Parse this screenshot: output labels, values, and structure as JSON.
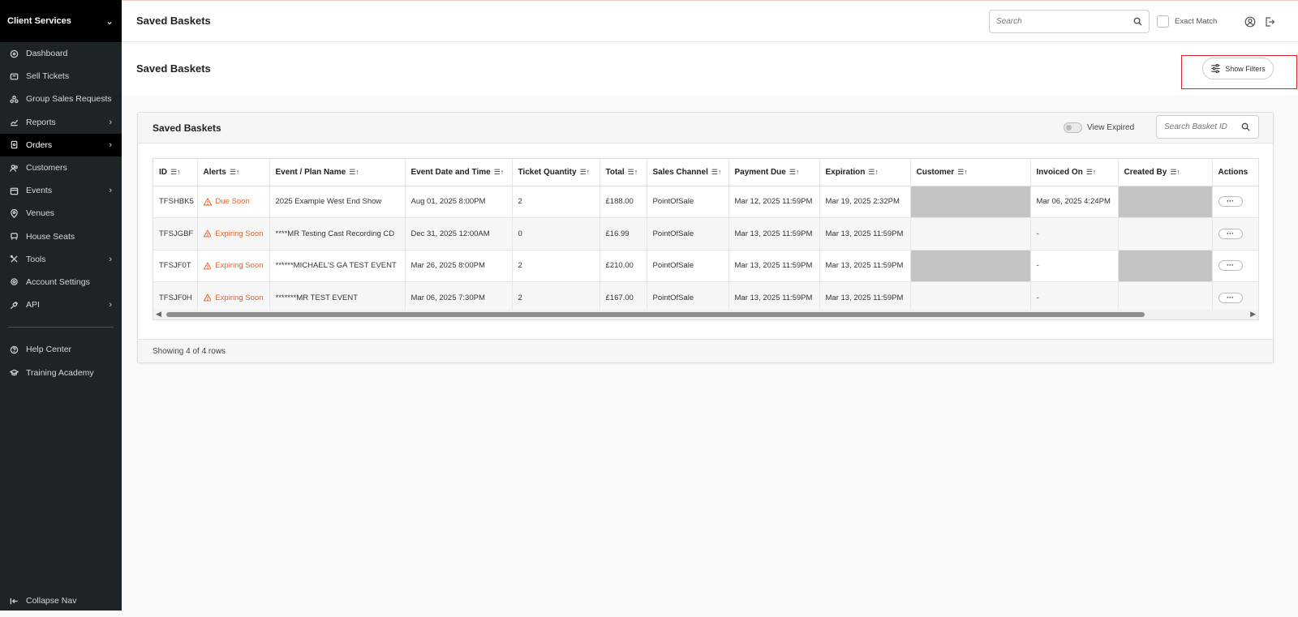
{
  "sidebar": {
    "org_name": "Client Services",
    "items": [
      {
        "label": "Dashboard",
        "icon": "dashboard-icon"
      },
      {
        "label": "Sell Tickets",
        "icon": "ticket-icon"
      },
      {
        "label": "Group Sales Requests",
        "icon": "group-icon"
      },
      {
        "label": "Reports",
        "icon": "chart-icon",
        "has_children": true
      },
      {
        "label": "Orders",
        "icon": "orders-icon",
        "has_children": true,
        "active": true
      },
      {
        "label": "Customers",
        "icon": "users-icon"
      },
      {
        "label": "Events",
        "icon": "calendar-icon",
        "has_children": true
      },
      {
        "label": "Venues",
        "icon": "location-icon"
      },
      {
        "label": "House Seats",
        "icon": "seat-icon"
      },
      {
        "label": "Tools",
        "icon": "tools-icon",
        "has_children": true
      },
      {
        "label": "Account Settings",
        "icon": "gear-icon"
      },
      {
        "label": "API",
        "icon": "plug-icon",
        "has_children": true
      }
    ],
    "secondary": [
      {
        "label": "Help Center",
        "icon": "help-icon"
      },
      {
        "label": "Training Academy",
        "icon": "graduation-icon"
      }
    ],
    "collapse_label": "Collapse Nav"
  },
  "topbar": {
    "title": "Saved Baskets",
    "search_placeholder": "Search",
    "exact_match_label": "Exact Match"
  },
  "page": {
    "title": "Saved Baskets",
    "show_filters_label": "Show Filters"
  },
  "card": {
    "title": "Saved Baskets",
    "view_expired_label": "View Expired",
    "basket_search_placeholder": "Search Basket ID",
    "footer": "Showing 4 of 4 rows"
  },
  "table": {
    "columns": [
      "ID",
      "Alerts",
      "Event / Plan Name",
      "Event Date and Time",
      "Ticket Quantity",
      "Total",
      "Sales Channel",
      "Payment Due",
      "Expiration",
      "Customer",
      "Invoiced On",
      "Created By",
      "Actions"
    ],
    "rows": [
      {
        "id": "TFSHBK5",
        "alert": "Due Soon",
        "event": "2025 Example West End Show",
        "event_date": "Aug 01, 2025 8:00PM",
        "qty": "2",
        "total": "£188.00",
        "channel": "PointOfSale",
        "payment_due": "Mar 12, 2025 11:59PM",
        "expiration": "Mar 19, 2025 2:32PM",
        "invoiced_on": "Mar 06, 2025 4:24PM"
      },
      {
        "id": "TFSJGBF",
        "alert": "Expiring Soon",
        "event": "****MR Testing Cast Recording CD",
        "event_date": "Dec 31, 2025 12:00AM",
        "qty": "0",
        "total": "£16.99",
        "channel": "PointOfSale",
        "payment_due": "Mar 13, 2025 11:59PM",
        "expiration": "Mar 13, 2025 11:59PM",
        "invoiced_on": "-"
      },
      {
        "id": "TFSJF0T",
        "alert": "Expiring Soon",
        "event": "******MICHAEL'S GA TEST EVENT",
        "event_date": "Mar 26, 2025 8:00PM",
        "qty": "2",
        "total": "£210.00",
        "channel": "PointOfSale",
        "payment_due": "Mar 13, 2025 11:59PM",
        "expiration": "Mar 13, 2025 11:59PM",
        "invoiced_on": "-"
      },
      {
        "id": "TFSJF0H",
        "alert": "Expiring Soon",
        "event": "*******MR TEST EVENT",
        "event_date": "Mar 06, 2025 7:30PM",
        "qty": "2",
        "total": "£167.00",
        "channel": "PointOfSale",
        "payment_due": "Mar 13, 2025 11:59PM",
        "expiration": "Mar 13, 2025 11:59PM",
        "invoiced_on": "-"
      }
    ],
    "actions_glyph": "···"
  },
  "colors": {
    "sidebar_bg": "#1e2326",
    "alert_orange": "#e5622b",
    "highlight_red": "#d9262c"
  }
}
